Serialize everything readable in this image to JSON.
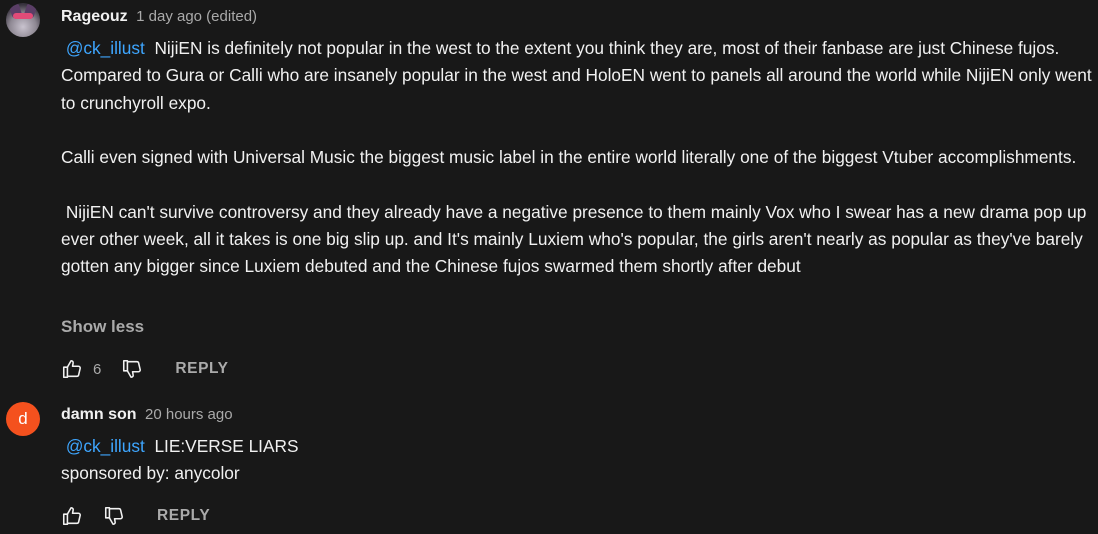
{
  "comments": [
    {
      "author": "Rageouz",
      "timestamp": "1 day ago (edited)",
      "mention": "@ck_illust",
      "paragraphs": [
        "NijiEN is definitely not popular in the west to the extent you think they are, most of their fanbase are just Chinese fujos. Compared to Gura or Calli who are insanely popular in the west and HoloEN went to panels all around the world while NijiEN only went to crunchyroll expo.",
        "Calli even signed with Universal Music the biggest music label in the entire world literally one of the biggest Vtuber accomplishments.",
        " NijiEN can't survive controversy and they already have a negative presence to them mainly Vox who I swear has a new drama pop up ever other week, all it takes is one big slip up. and It's mainly Luxiem who's popular, the girls aren't nearly as popular as they've barely gotten any bigger since Luxiem debuted and the Chinese fujos swarmed them shortly after debut"
      ],
      "show_less_label": "Show less",
      "like_count": "6",
      "reply_label": "REPLY",
      "avatar_icon": "cat-avatar-icon"
    },
    {
      "author": "damn son",
      "timestamp": "20 hours ago",
      "mention": "@ck_illust",
      "line1": "LIE:VERSE LIARS",
      "line2": "sponsored by: anycolor",
      "avatar_letter": "d",
      "avatar_color": "#f4511e",
      "reply_label": "REPLY"
    }
  ],
  "colors": {
    "background": "#181818",
    "text": "#f1f1f1",
    "secondary_text": "#aaaaaa",
    "link": "#3ea6ff"
  }
}
